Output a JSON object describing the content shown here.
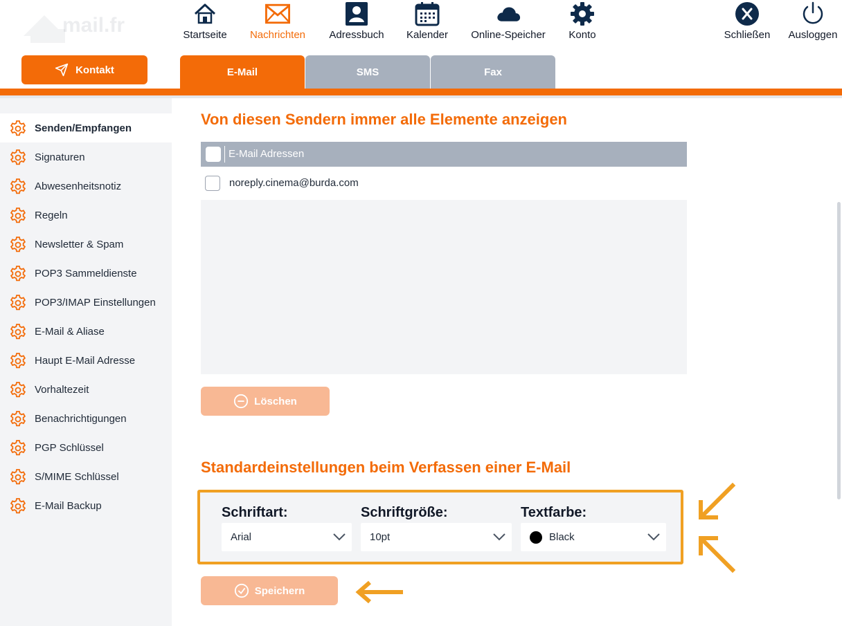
{
  "brand": {
    "logo_text": "mail.fr"
  },
  "contact_button": {
    "label": "Kontakt"
  },
  "nav": {
    "startseite": "Startseite",
    "nachrichten": "Nachrichten",
    "adressbuch": "Adressbuch",
    "kalender": "Kalender",
    "online_speicher": "Online-Speicher",
    "konto": "Konto",
    "schliessen": "Schließen",
    "ausloggen": "Ausloggen"
  },
  "tabs": {
    "email": "E-Mail",
    "sms": "SMS",
    "fax": "Fax"
  },
  "sidebar": {
    "items": [
      {
        "label": "Senden/Empfangen",
        "active": true
      },
      {
        "label": "Signaturen"
      },
      {
        "label": "Abwesenheitsnotiz"
      },
      {
        "label": "Regeln"
      },
      {
        "label": "Newsletter & Spam"
      },
      {
        "label": "POP3 Sammeldienste"
      },
      {
        "label": "POP3/IMAP Einstellungen"
      },
      {
        "label": "E-Mail & Aliase"
      },
      {
        "label": "Haupt E-Mail Adresse"
      },
      {
        "label": "Vorhaltezeit"
      },
      {
        "label": "Benachrichtigungen"
      },
      {
        "label": "PGP Schlüssel"
      },
      {
        "label": "S/MIME Schlüssel"
      },
      {
        "label": "E-Mail Backup"
      }
    ]
  },
  "senders": {
    "title": "Von diesen Sendern immer alle Elemente anzeigen",
    "column_header": "E-Mail Adressen",
    "rows": [
      "noreply.cinema@burda.com"
    ],
    "delete_label": "Löschen"
  },
  "compose_defaults": {
    "title": "Standardeinstellungen beim Verfassen einer E-Mail",
    "font_label": "Schriftart:",
    "font_value": "Arial",
    "size_label": "Schriftgröße:",
    "size_value": "10pt",
    "color_label": "Textfarbe:",
    "color_value": "Black",
    "color_swatch": "#000000",
    "save_label": "Speichern"
  },
  "colors": {
    "accent": "#f36b08",
    "accent_faded": "#f8b894",
    "tab_inactive": "#a7b0bd",
    "highlight": "#f0a023"
  }
}
